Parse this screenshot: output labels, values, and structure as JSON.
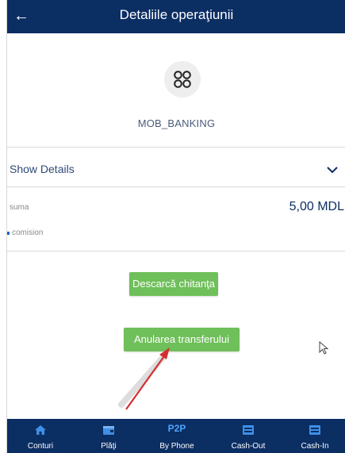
{
  "header": {
    "title": "Detaliile operaţiunii",
    "back_icon": "back-arrow-icon"
  },
  "service": {
    "icon": "service-circles-icon",
    "name": "MOB_BANKING"
  },
  "details": {
    "toggle_label": "Show Details",
    "chevron_icon": "chevron-down-icon"
  },
  "rows": [
    {
      "label": "suma",
      "value": "5,00 MDL"
    },
    {
      "label": "comision",
      "value": ""
    }
  ],
  "buttons": {
    "receipt": "Descarcă chitanţa",
    "cancel": "Anularea transferului"
  },
  "tabs": [
    {
      "label": "Conturi",
      "icon": "home-icon"
    },
    {
      "label": "Plăţi",
      "icon": "wallet-icon"
    },
    {
      "label": "By Phone",
      "icon": "p2p-icon",
      "badge": "P2P"
    },
    {
      "label": "Cash-Out",
      "icon": "cash-out-icon"
    },
    {
      "label": "Cash-In",
      "icon": "cash-in-icon"
    }
  ],
  "colors": {
    "header": "#0b2e63",
    "accent": "#1f66c8",
    "button": "#6fbf5a",
    "annotation_arrow": "#d32f2f"
  }
}
